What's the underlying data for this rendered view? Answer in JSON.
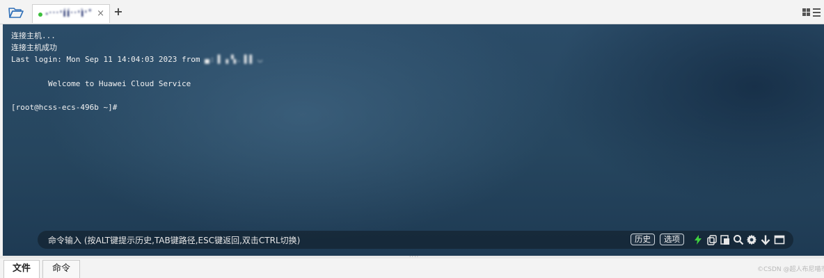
{
  "tab_bar": {
    "folder_icon": "folder-open-icon",
    "session_tab": {
      "status_color": "#3cbf3c",
      "title": "·ˑˑˑ'ÍÍˑˑ'Ì'˚",
      "close_label": "×"
    },
    "add_tab_label": "+",
    "layout_icon": "grid-menu-icon"
  },
  "terminal": {
    "lines": [
      "连接主机...",
      "连接主机成功",
      "Last login: Mon Sep 11 14:04:03 2023 from ",
      "",
      "        Welcome to Huawei Cloud Service",
      "",
      "[root@hcss-ecs-496b ~]#"
    ],
    "redacted_ip": "▄:▐ ▖▚.▐▐ ◡"
  },
  "command_bar": {
    "placeholder": "命令输入 (按ALT键提示历史,TAB键路径,ESC键返回,双击CTRL切换)",
    "history_label": "历史",
    "options_label": "选项",
    "tools": [
      "lightning-icon",
      "copy-icon",
      "paste-icon",
      "search-icon",
      "gear-icon",
      "arrow-down-icon",
      "maximize-icon"
    ]
  },
  "bottom_tabs": [
    {
      "label": "文件",
      "active": true
    },
    {
      "label": "命令",
      "active": false
    }
  ],
  "watermark": "©CSDN @超人布尼喵币几"
}
